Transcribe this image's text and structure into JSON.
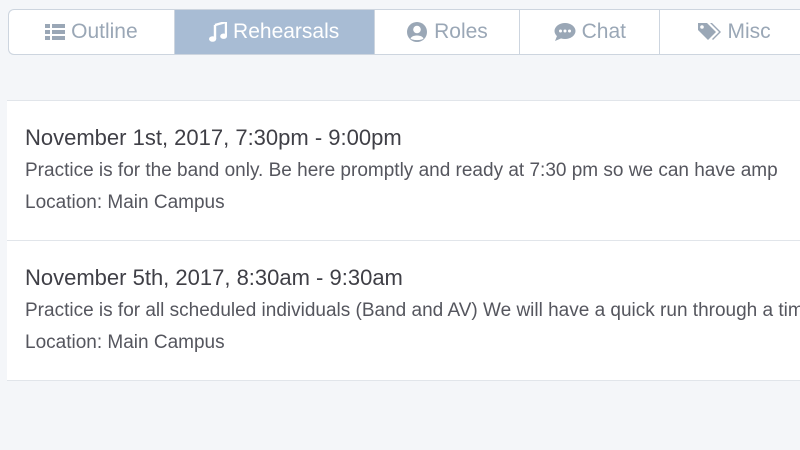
{
  "tabs": [
    {
      "label": "Outline",
      "icon": "list-icon",
      "active": false
    },
    {
      "label": "Rehearsals",
      "icon": "music-note-icon",
      "active": true
    },
    {
      "label": "Roles",
      "icon": "user-circle-icon",
      "active": false
    },
    {
      "label": "Chat",
      "icon": "chat-bubble-icon",
      "active": false
    },
    {
      "label": "Misc",
      "icon": "tags-icon",
      "active": false
    }
  ],
  "rehearsals": [
    {
      "title": "November 1st, 2017, 7:30pm - 9:00pm",
      "description": "Practice is for the band only. Be here promptly and ready at 7:30 pm so we can have amp",
      "location": "Location: Main Campus"
    },
    {
      "title": "November 5th, 2017, 8:30am - 9:30am",
      "description": "Practice is for all scheduled individuals (Band and AV) We will have a quick run through a time.",
      "location": "Location: Main Campus"
    }
  ],
  "colors": {
    "active_tab_bg": "#a8bcd4",
    "tab_text": "#9aa7b6",
    "page_bg": "#f4f6f9"
  }
}
